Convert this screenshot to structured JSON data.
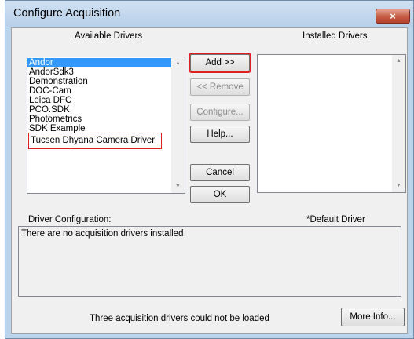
{
  "window": {
    "title": "Configure Acquisition",
    "close_glyph": "×"
  },
  "available_drivers": {
    "label": "Available Drivers",
    "items": [
      {
        "label": "Andor",
        "selected": true
      },
      {
        "label": "AndorSdk3"
      },
      {
        "label": "Demonstration"
      },
      {
        "label": "DOC-Cam"
      },
      {
        "label": "Leica DFC"
      },
      {
        "label": "PCO.SDK"
      },
      {
        "label": "Photometrics"
      },
      {
        "label": "SDK Example"
      },
      {
        "label": "Tucsen Dhyana Camera Driver",
        "highlighted": true
      }
    ]
  },
  "installed_drivers": {
    "label": "Installed Drivers",
    "items": []
  },
  "buttons": {
    "add": "Add >>",
    "remove": "<< Remove",
    "configure": "Configure...",
    "help": "Help...",
    "cancel": "Cancel",
    "ok": "OK",
    "more_info": "More Info..."
  },
  "driver_configuration": {
    "label": "Driver Configuration:",
    "default_driver_label": "*Default Driver",
    "text": "There are no acquisition drivers installed"
  },
  "status": {
    "message": "Three acquisition drivers could not be loaded"
  },
  "icons": {
    "scroll_up": "▲",
    "scroll_down": "▼"
  },
  "colors": {
    "selection": "#3399ff",
    "highlight_outline": "#e02020",
    "close_button": "#c45a43"
  }
}
